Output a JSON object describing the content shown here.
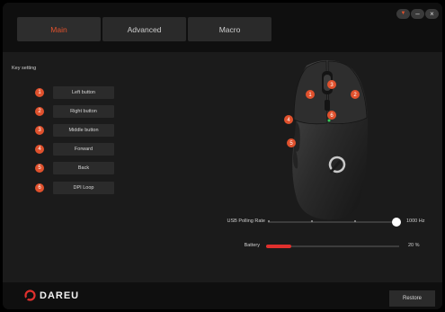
{
  "tabs": [
    {
      "label": "Main",
      "active": true
    },
    {
      "label": "Advanced",
      "active": false
    },
    {
      "label": "Macro",
      "active": false
    }
  ],
  "window_controls": {
    "menu_icon": "down-triangle-icon",
    "minimize": "–",
    "close": "×"
  },
  "key_setting": {
    "title": "Key setting",
    "items": [
      {
        "num": "1",
        "label": "Left button"
      },
      {
        "num": "2",
        "label": "Right button"
      },
      {
        "num": "3",
        "label": "Middle button"
      },
      {
        "num": "4",
        "label": "Forward"
      },
      {
        "num": "5",
        "label": "Back"
      },
      {
        "num": "6",
        "label": "DPI Loop"
      }
    ]
  },
  "mouse_markers": [
    "1",
    "2",
    "3",
    "4",
    "5",
    "6"
  ],
  "polling": {
    "label": "USB Polling Rate",
    "value": "1000 Hz",
    "level": 1.0
  },
  "battery": {
    "label": "Battery",
    "value": "20 %",
    "percent": 20
  },
  "footer": {
    "brand": "DAREU",
    "restore_label": "Restore"
  },
  "colors": {
    "accent": "#e0512d",
    "battery_fill": "#e0302d",
    "background": "#1b1b1b"
  }
}
